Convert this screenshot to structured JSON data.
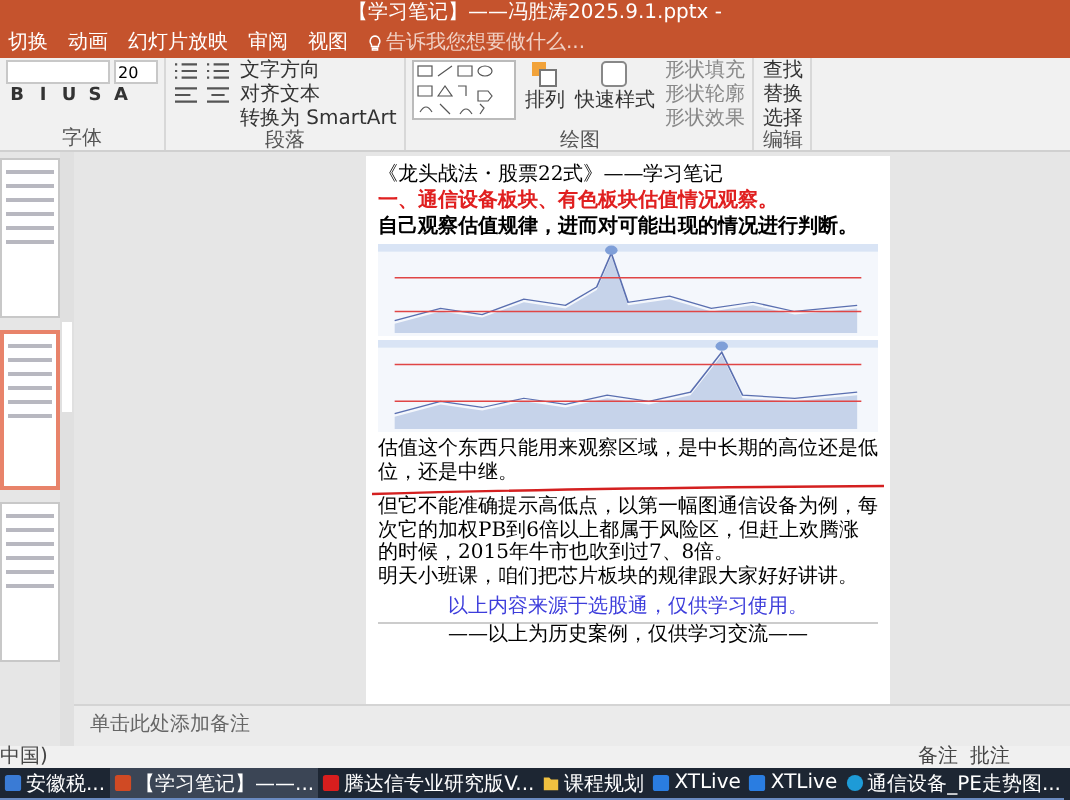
{
  "window": {
    "title": "【学习笔记】——冯胜涛2025.9.1.pptx -"
  },
  "menu_tabs": [
    {
      "label": "切换",
      "selected": false
    },
    {
      "label": "动画",
      "selected": false
    },
    {
      "label": "幻灯片放映",
      "selected": false
    },
    {
      "label": "审阅",
      "selected": false
    },
    {
      "label": "视图",
      "selected": false
    }
  ],
  "tell_me": {
    "placeholder": "告诉我您想要做什么..."
  },
  "ribbon_groups": [
    {
      "kind": "font",
      "label": "字体",
      "size": "20",
      "buttons": [
        "B",
        "I",
        "U",
        "S",
        "A"
      ]
    },
    {
      "kind": "paragraph",
      "label": "段落",
      "buttons": [
        "文字方向",
        "对齐文本",
        "转换为 SmartArt"
      ]
    },
    {
      "kind": "drawing",
      "label": "绘图",
      "buttons": [
        "排列",
        "快速样式",
        "形状填充",
        "形状轮廓",
        "形状效果"
      ]
    },
    {
      "kind": "editing",
      "label": "编辑",
      "buttons": [
        "查找",
        "替换",
        "选择"
      ]
    }
  ],
  "thumbnails": [
    {
      "selected": false
    },
    {
      "selected": true
    },
    {
      "selected": false
    }
  ],
  "slide": {
    "title": "《龙头战法・股票22式》——学习笔记",
    "heading": "一、通信设备板块、有色板块估值情况观察。",
    "subheading": "自己观察估值规律，进而对可能出现的情况进行判断。",
    "body": [
      "估值这个东西只能用来观察区域，是中长期的高位还是低位，还是中继。",
      "但它不能准确提示高低点，以第一幅图通信设备为例，每次它的加权PB到6倍以上都属于风险区，但赶上欢腾涨的时候，2015年牛市也吹到过7、8倍。",
      "明天小班课，咱们把芯片板块的规律跟大家好好讲讲。"
    ],
    "source": "以上内容来源于选股通，仅供学习使用。",
    "footer": "——以上为历史案例，仅供学习交流——"
  },
  "notes_placeholder": "单击此处添加备注",
  "status_bar": {
    "language": "中国)",
    "buttons": [
      "备注",
      "批注"
    ]
  },
  "taskbar": [
    {
      "kind": "app",
      "label": "安徽税...",
      "selected": false
    },
    {
      "kind": "powerpoint",
      "label": "【学习笔记】——...",
      "selected": true
    },
    {
      "kind": "stock",
      "label": "腾达信专业研究版V...",
      "selected": false
    },
    {
      "kind": "folder",
      "label": "课程规划",
      "selected": false
    },
    {
      "kind": "live",
      "label": "XTLive",
      "selected": false
    },
    {
      "kind": "live",
      "label": "XTLive",
      "selected": false
    },
    {
      "kind": "edge",
      "label": "通信设备_PE走势图...",
      "selected": false
    }
  ]
}
